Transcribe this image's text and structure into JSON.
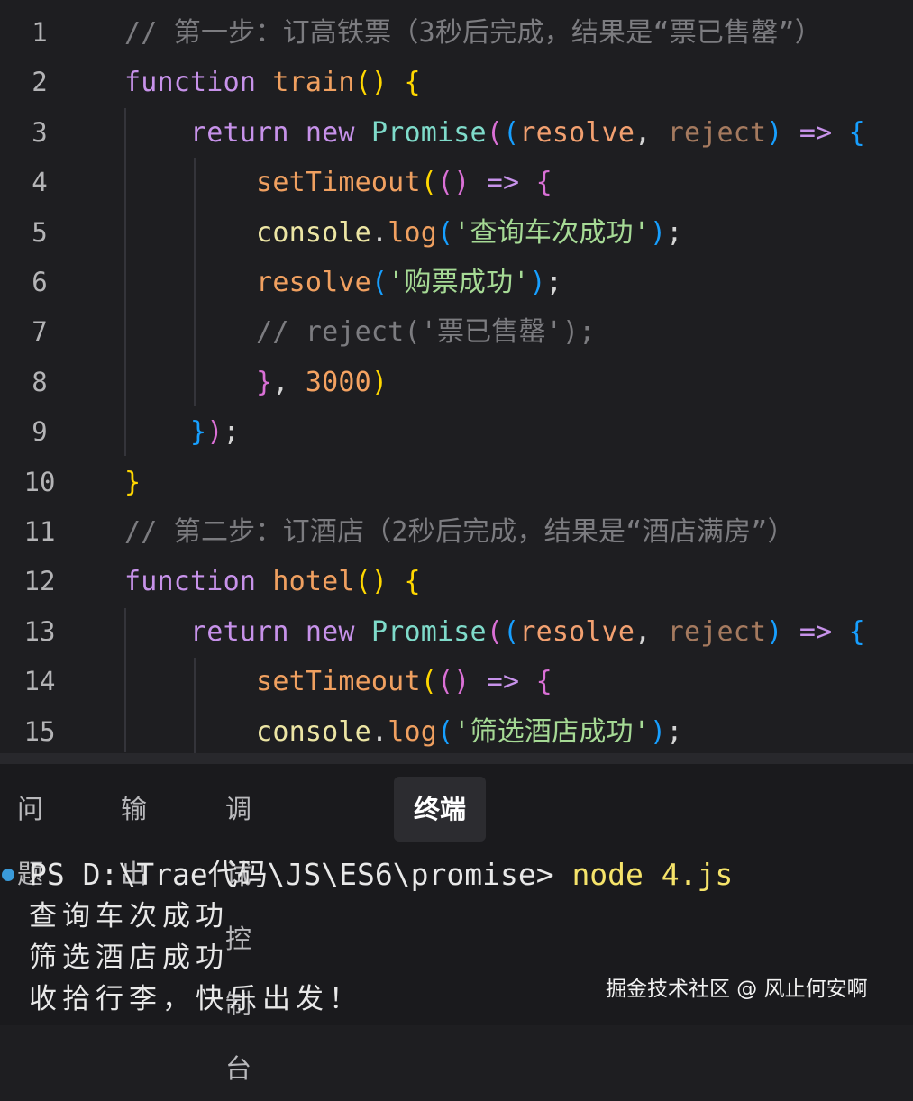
{
  "editor": {
    "lines": [
      {
        "n": "1",
        "tokens": [
          [
            "c-comment",
            "// 第一步：订高铁票（3秒后完成，结果是“票已售罄”）"
          ]
        ]
      },
      {
        "n": "2",
        "tokens": [
          [
            "c-kw",
            "function"
          ],
          [
            "c-punc",
            " "
          ],
          [
            "c-fn",
            "train"
          ],
          [
            "b1",
            "()"
          ],
          [
            "c-punc",
            " "
          ],
          [
            "b1",
            "{"
          ]
        ]
      },
      {
        "n": "3",
        "tokens": [
          [
            "c-punc",
            "    "
          ],
          [
            "c-kw",
            "return"
          ],
          [
            "c-punc",
            " "
          ],
          [
            "c-kw",
            "new"
          ],
          [
            "c-punc",
            " "
          ],
          [
            "c-type",
            "Promise"
          ],
          [
            "b2",
            "("
          ],
          [
            "b3",
            "("
          ],
          [
            "c-param",
            "resolve"
          ],
          [
            "c-punc",
            ", "
          ],
          [
            "c-param2",
            "reject"
          ],
          [
            "b3",
            ")"
          ],
          [
            "c-punc",
            " "
          ],
          [
            "c-op",
            "=>"
          ],
          [
            "c-punc",
            " "
          ],
          [
            "b3",
            "{"
          ]
        ]
      },
      {
        "n": "4",
        "tokens": [
          [
            "c-punc",
            "        "
          ],
          [
            "c-fnc",
            "setTimeout"
          ],
          [
            "b1",
            "("
          ],
          [
            "b2",
            "()"
          ],
          [
            "c-punc",
            " "
          ],
          [
            "c-op",
            "=>"
          ],
          [
            "c-punc",
            " "
          ],
          [
            "b2",
            "{"
          ]
        ]
      },
      {
        "n": "5",
        "tokens": [
          [
            "c-punc",
            "        "
          ],
          [
            "c-var",
            "console"
          ],
          [
            "c-punc",
            "."
          ],
          [
            "c-fnc",
            "log"
          ],
          [
            "b3",
            "("
          ],
          [
            "c-str",
            "'查询车次成功'"
          ],
          [
            "b3",
            ")"
          ],
          [
            "c-punc",
            ";"
          ]
        ]
      },
      {
        "n": "6",
        "tokens": [
          [
            "c-punc",
            "        "
          ],
          [
            "c-fnc",
            "resolve"
          ],
          [
            "b3",
            "("
          ],
          [
            "c-str",
            "'购票成功'"
          ],
          [
            "b3",
            ")"
          ],
          [
            "c-punc",
            ";"
          ]
        ]
      },
      {
        "n": "7",
        "tokens": [
          [
            "c-punc",
            "        "
          ],
          [
            "c-comment",
            "// reject('票已售罄');"
          ]
        ]
      },
      {
        "n": "8",
        "tokens": [
          [
            "c-punc",
            "        "
          ],
          [
            "b2",
            "}"
          ],
          [
            "c-punc",
            ", "
          ],
          [
            "c-num",
            "3000"
          ],
          [
            "b1",
            ")"
          ]
        ]
      },
      {
        "n": "9",
        "tokens": [
          [
            "c-punc",
            "    "
          ],
          [
            "b3",
            "}"
          ],
          [
            "b2",
            ")"
          ],
          [
            "c-punc",
            ";"
          ]
        ]
      },
      {
        "n": "10",
        "tokens": [
          [
            "b1",
            "}"
          ]
        ]
      },
      {
        "n": "11",
        "tokens": [
          [
            "c-comment",
            "// 第二步：订酒店（2秒后完成，结果是“酒店满房”）"
          ]
        ]
      },
      {
        "n": "12",
        "tokens": [
          [
            "c-kw",
            "function"
          ],
          [
            "c-punc",
            " "
          ],
          [
            "c-fn",
            "hotel"
          ],
          [
            "b1",
            "()"
          ],
          [
            "c-punc",
            " "
          ],
          [
            "b1",
            "{"
          ]
        ]
      },
      {
        "n": "13",
        "tokens": [
          [
            "c-punc",
            "    "
          ],
          [
            "c-kw",
            "return"
          ],
          [
            "c-punc",
            " "
          ],
          [
            "c-kw",
            "new"
          ],
          [
            "c-punc",
            " "
          ],
          [
            "c-type",
            "Promise"
          ],
          [
            "b2",
            "("
          ],
          [
            "b3",
            "("
          ],
          [
            "c-param",
            "resolve"
          ],
          [
            "c-punc",
            ", "
          ],
          [
            "c-param2",
            "reject"
          ],
          [
            "b3",
            ")"
          ],
          [
            "c-punc",
            " "
          ],
          [
            "c-op",
            "=>"
          ],
          [
            "c-punc",
            " "
          ],
          [
            "b3",
            "{"
          ]
        ]
      },
      {
        "n": "14",
        "tokens": [
          [
            "c-punc",
            "        "
          ],
          [
            "c-fnc",
            "setTimeout"
          ],
          [
            "b1",
            "("
          ],
          [
            "b2",
            "()"
          ],
          [
            "c-punc",
            " "
          ],
          [
            "c-op",
            "=>"
          ],
          [
            "c-punc",
            " "
          ],
          [
            "b2",
            "{"
          ]
        ]
      },
      {
        "n": "15",
        "tokens": [
          [
            "c-punc",
            "        "
          ],
          [
            "c-var",
            "console"
          ],
          [
            "c-punc",
            "."
          ],
          [
            "c-fnc",
            "log"
          ],
          [
            "b3",
            "("
          ],
          [
            "c-str",
            "'筛选酒店成功'"
          ],
          [
            "b3",
            ")"
          ],
          [
            "c-punc",
            ";"
          ]
        ]
      }
    ]
  },
  "panel": {
    "tabs": [
      {
        "label": "问题"
      },
      {
        "label": "输出"
      },
      {
        "label": "调试控制台"
      },
      {
        "label": "终端"
      }
    ],
    "terminal": {
      "prompt": "PS D:\\Trae代码\\JS\\ES6\\promise> ",
      "command": "node 4.js",
      "output": [
        "查询车次成功",
        "筛选酒店成功",
        "收拾行李，快乐出发！"
      ]
    }
  },
  "watermark": "掘金技术社区 @ 风止何安啊"
}
